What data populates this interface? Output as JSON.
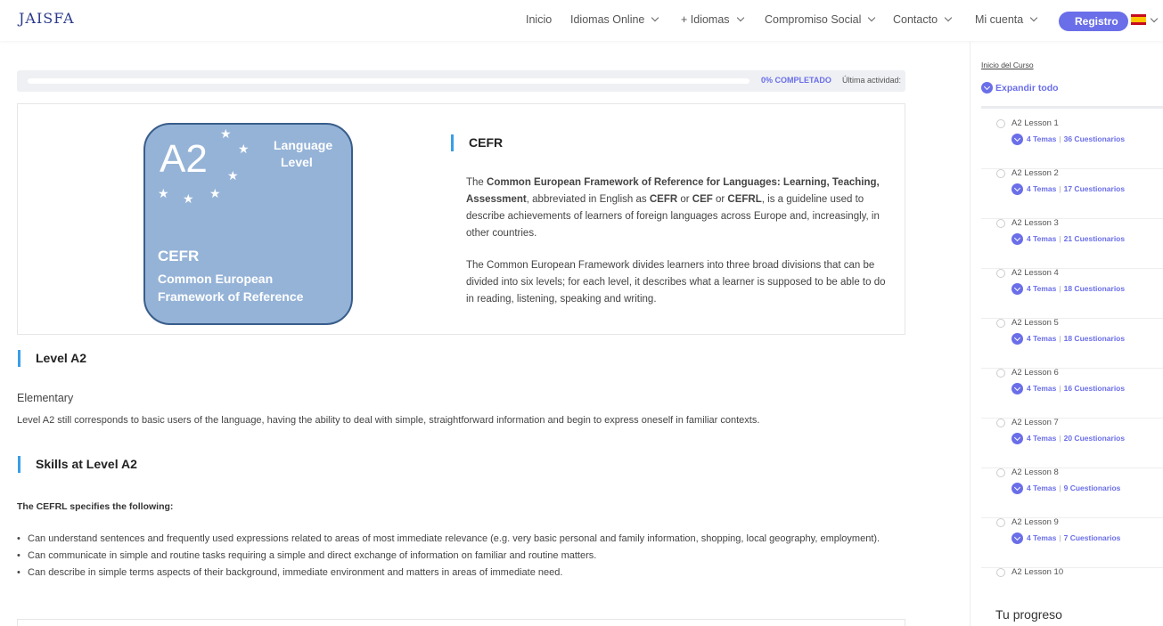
{
  "header": {
    "logo": "JAISFA",
    "nav": [
      "Inicio",
      "Idiomas Online",
      "+ Idiomas",
      "Compromiso Social",
      "Contacto",
      "Mi cuenta"
    ],
    "register": "Registro",
    "flag_icon": "spain-flag-icon"
  },
  "progress": {
    "percent": 0,
    "label": "0% COMPLETADO",
    "last_activity": "Última actividad:"
  },
  "cefr_card": {
    "badge": {
      "level": "A2",
      "lang_line1": "Language",
      "lang_line2": "Level",
      "cefr": "CEFR",
      "line1": "Common European",
      "line2": "Framework of Reference"
    },
    "title": "CEFR",
    "p1": "The Common European Framework of Reference for Languages: Learning, Teaching, Assessment, abbreviated in English as CEFR or CEF or CEFRL, is a guideline used to describe achievements of learners of foreign languages across Europe and, increasingly, in other countries.",
    "p2": "The Common European Framework divides learners into three broad divisions that can be divided into six levels; for each level, it describes what a learner is supposed to be able to do in reading, listening, speaking and writing."
  },
  "level": {
    "title": "Level A2",
    "subtitle": "Elementary",
    "desc": "Level A2 still corresponds to basic users of the language, having the ability to deal with simple, straightforward information and begin to express oneself in familiar contexts."
  },
  "skills": {
    "title": "Skills at Level A2",
    "intro": "The CEFRL specifies the following:",
    "items": [
      "Can understand sentences and frequently used expressions related to areas of most immediate relevance (e.g. very basic personal and family information, shopping, local geography, employment).",
      "Can communicate in simple and routine tasks requiring a simple and direct exchange of information on familiar and routine matters.",
      "Can describe in simple terms aspects of their background, immediate environment and matters in areas of immediate need."
    ]
  },
  "sidebar": {
    "course_home": "Inicio del Curso",
    "expand_all": "Expandir todo",
    "lessons": [
      {
        "label": "A2 Lesson 1",
        "topics": "4 Temas",
        "quizzes": "36 Cuestionarios"
      },
      {
        "label": "A2 Lesson 2",
        "topics": "4 Temas",
        "quizzes": "17 Cuestionarios"
      },
      {
        "label": "A2 Lesson 3",
        "topics": "4 Temas",
        "quizzes": "21 Cuestionarios"
      },
      {
        "label": "A2 Lesson 4",
        "topics": "4 Temas",
        "quizzes": "18 Cuestionarios"
      },
      {
        "label": "A2 Lesson 5",
        "topics": "4 Temas",
        "quizzes": "18 Cuestionarios"
      },
      {
        "label": "A2 Lesson 6",
        "topics": "4 Temas",
        "quizzes": "16 Cuestionarios"
      },
      {
        "label": "A2 Lesson 7",
        "topics": "4 Temas",
        "quizzes": "20 Cuestionarios"
      },
      {
        "label": "A2 Lesson 8",
        "topics": "4 Temas",
        "quizzes": "9 Cuestionarios"
      },
      {
        "label": "A2 Lesson 9",
        "topics": "4 Temas",
        "quizzes": "7 Cuestionarios"
      },
      {
        "label": "A2 Lesson 10"
      }
    ],
    "progress_title": "Tu progreso"
  },
  "colors": {
    "accent": "#6a6ee8",
    "heading_bar": "#3a9ee8",
    "badge_fill": "#95b3d7",
    "badge_border": "#385d8a"
  }
}
